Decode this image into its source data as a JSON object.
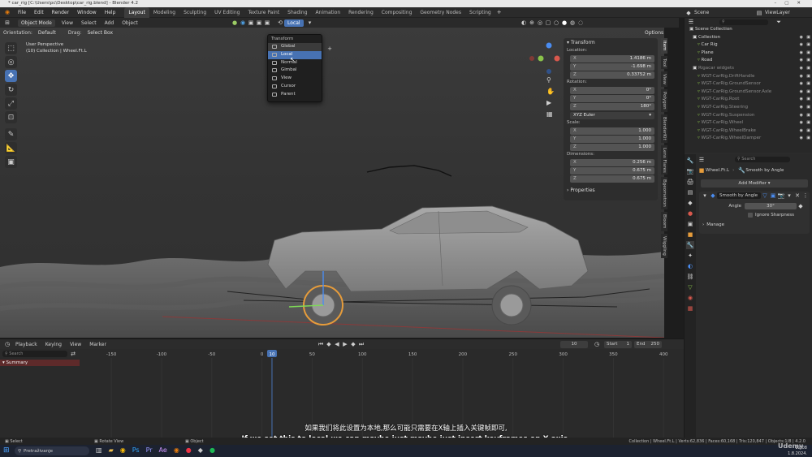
{
  "window": {
    "title": "* car_rig [C:\\Users\\pc\\Desktop\\car_rig.blend] - Blender 4.2"
  },
  "menu": [
    "File",
    "Edit",
    "Render",
    "Window",
    "Help"
  ],
  "workspaces": [
    "Layout",
    "Modeling",
    "Sculpting",
    "UV Editing",
    "Texture Paint",
    "Shading",
    "Animation",
    "Rendering",
    "Compositing",
    "Geometry Nodes",
    "Scripting"
  ],
  "scene": {
    "scene_name": "Scene",
    "view_layer": "ViewLayer"
  },
  "viewport_header": {
    "mode": "Object Mode",
    "view": "View",
    "select": "Select",
    "add": "Add",
    "object": "Object",
    "orientation_label": "Orientation:",
    "orientation_value": "Default",
    "drag_label": "Drag:",
    "drag_value": "Select Box",
    "transform_orientation": "Local",
    "options": "Options"
  },
  "viewport_overlay": {
    "line1": "User Perspective",
    "line2": "(10) Collection | Wheel.Ft.L"
  },
  "dropdown": {
    "title": "Transform Orientations",
    "items": [
      "Global",
      "Local",
      "Normal",
      "Gimbal",
      "View",
      "Cursor",
      "Parent"
    ],
    "selected": "Local",
    "hovered": "Global"
  },
  "transform_panel": {
    "title": "Transform",
    "location_label": "Location:",
    "location": [
      {
        "k": "X",
        "v": "1.4186 m"
      },
      {
        "k": "Y",
        "v": "-1.698 m"
      },
      {
        "k": "Z",
        "v": "0.33752 m"
      }
    ],
    "rotation_label": "Rotation:",
    "rotation": [
      {
        "k": "X",
        "v": "0°"
      },
      {
        "k": "Y",
        "v": "0°"
      },
      {
        "k": "Z",
        "v": "180°"
      }
    ],
    "rotation_mode": "XYZ Euler",
    "scale_label": "Scale:",
    "scale": [
      {
        "k": "X",
        "v": "1.000"
      },
      {
        "k": "Y",
        "v": "1.000"
      },
      {
        "k": "Z",
        "v": "1.000"
      }
    ],
    "dimensions_label": "Dimensions:",
    "dimensions": [
      {
        "k": "X",
        "v": "0.256 m"
      },
      {
        "k": "Y",
        "v": "0.675 m"
      },
      {
        "k": "Z",
        "v": "0.675 m"
      }
    ],
    "properties": "Properties"
  },
  "side_tabs": [
    "Item",
    "Tool",
    "View",
    "Polygon",
    "BlenderKit",
    "Lens Flares",
    "Bgeometron",
    "Bloom",
    "Wiggling"
  ],
  "outliner": {
    "header": "Scene Collection",
    "rows": [
      {
        "label": "Collection",
        "indent": 1,
        "dim": false
      },
      {
        "label": "Car Rig",
        "indent": 2,
        "dim": false
      },
      {
        "label": "Plane",
        "indent": 2,
        "dim": false
      },
      {
        "label": "Road",
        "indent": 2,
        "dim": false
      },
      {
        "label": "Rigacar widgets",
        "indent": 1,
        "dim": true
      },
      {
        "label": "WGT-CarRig.DriftHandle",
        "indent": 2,
        "dim": true
      },
      {
        "label": "WGT-CarRig.GroundSensor",
        "indent": 2,
        "dim": true
      },
      {
        "label": "WGT-CarRig.GroundSensor.Axle",
        "indent": 2,
        "dim": true
      },
      {
        "label": "WGT-CarRig.Root",
        "indent": 2,
        "dim": true
      },
      {
        "label": "WGT-CarRig.Steering",
        "indent": 2,
        "dim": true
      },
      {
        "label": "WGT-CarRig.Suspension",
        "indent": 2,
        "dim": true
      },
      {
        "label": "WGT-CarRig.Wheel",
        "indent": 2,
        "dim": true
      },
      {
        "label": "WGT-CarRig.WheelBrake",
        "indent": 2,
        "dim": true
      },
      {
        "label": "WGT-CarRig.WheelDamper",
        "indent": 2,
        "dim": true
      }
    ]
  },
  "properties": {
    "object_name": "Wheel.Ft.L",
    "modifier_tab": "Smooth by Angle",
    "add_modifier": "Add Modifier",
    "modifier_name": "Smooth by Angle",
    "angle_label": "Angle",
    "angle_value": "30°",
    "ignore_sharpness": "Ignore Sharpness",
    "manage": "Manage"
  },
  "timeline": {
    "menus": [
      "Playback",
      "Keying",
      "View",
      "Marker"
    ],
    "current_frame": "10",
    "start_label": "Start",
    "start": "1",
    "end_label": "End",
    "end": "250",
    "search_placeholder": "Search",
    "summary": "Summary",
    "ruler": [
      "-150",
      "-100",
      "-50",
      "0",
      "50",
      "100",
      "150",
      "200",
      "250",
      "300",
      "350",
      "400"
    ],
    "ruler_frames": [
      -150,
      -100,
      -50,
      0,
      50,
      100,
      150,
      200,
      250,
      300,
      350,
      400
    ],
    "playhead_frame": 10
  },
  "subtitles": {
    "zh": "如果我们将此设置为本地,那么可能只需要在X轴上插入关键帧即可,",
    "en": "If we set this to local,we can maybe just maybe just insert keyframes on X axis,"
  },
  "status": {
    "left1": "Select",
    "left2": "Rotate View",
    "left3": "Object",
    "right": "Collection | Wheel.Ft.L | Verts:62,836 | Faces:60,168 | Tris:120,847 | Objects:1/8 | 4.2.0"
  },
  "taskbar": {
    "search": "Pretraživanje",
    "time": "22:08",
    "date": "1.8.2024."
  },
  "watermark": "Udemy"
}
